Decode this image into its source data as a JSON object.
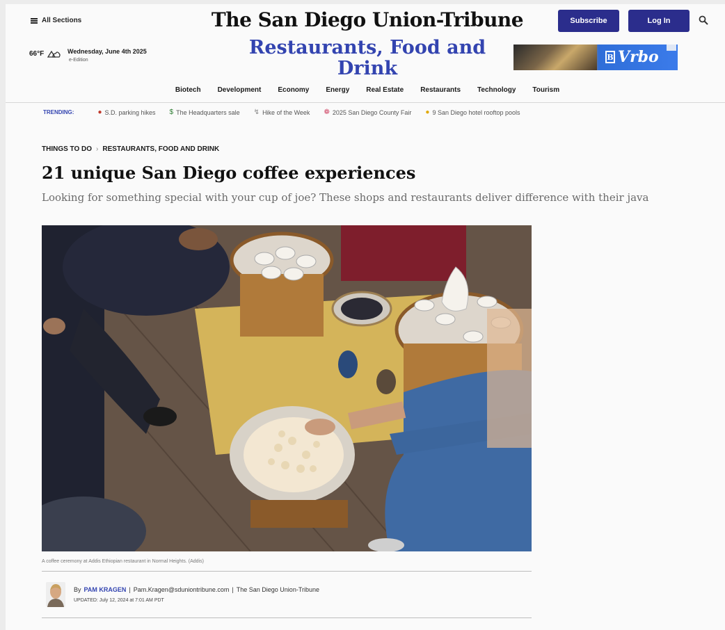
{
  "header": {
    "all_sections": "All Sections",
    "masthead": "The San Diego Union-Tribune",
    "subscribe": "Subscribe",
    "login": "Log In",
    "temperature": "66°F",
    "date": "Wednesday, June 4th 2025",
    "edition": "e-Edition",
    "section_title": "Restaurants, Food and Drink",
    "ad_brand": "Vrbo"
  },
  "nav": {
    "items": [
      "Biotech",
      "Development",
      "Economy",
      "Energy",
      "Real Estate",
      "Restaurants",
      "Technology",
      "Tourism"
    ]
  },
  "trending": {
    "label": "TRENDING:",
    "items": [
      {
        "icon": "car-icon",
        "label": "S.D. parking hikes"
      },
      {
        "icon": "money-icon",
        "label": "The Headquarters sale"
      },
      {
        "icon": "hiker-icon",
        "label": "Hike of the Week"
      },
      {
        "icon": "ferris-wheel-icon",
        "label": "2025 San Diego County Fair"
      },
      {
        "icon": "sunglasses-icon",
        "label": "9 San Diego hotel rooftop pools"
      }
    ]
  },
  "article": {
    "breadcrumb": [
      "THINGS TO DO",
      "RESTAURANTS, FOOD AND DRINK"
    ],
    "headline": "21 unique San Diego coffee experiences",
    "dek": "Looking for something special with your cup of joe? These shops and restaurants deliver difference with their java",
    "caption": "A coffee ceremony at Addis Ethiopian restaurant in Normal Heights. (Addis)",
    "byline_prefix": "By",
    "author": "PAM KRAGEN",
    "email": "Pam.Kragen@sduniontribune.com",
    "publication": "The San Diego Union-Tribune",
    "updated": "UPDATED: July 12, 2024 at 7:01 AM PDT"
  },
  "colors": {
    "accent": "#2b2d8c",
    "link": "#3344b0"
  }
}
